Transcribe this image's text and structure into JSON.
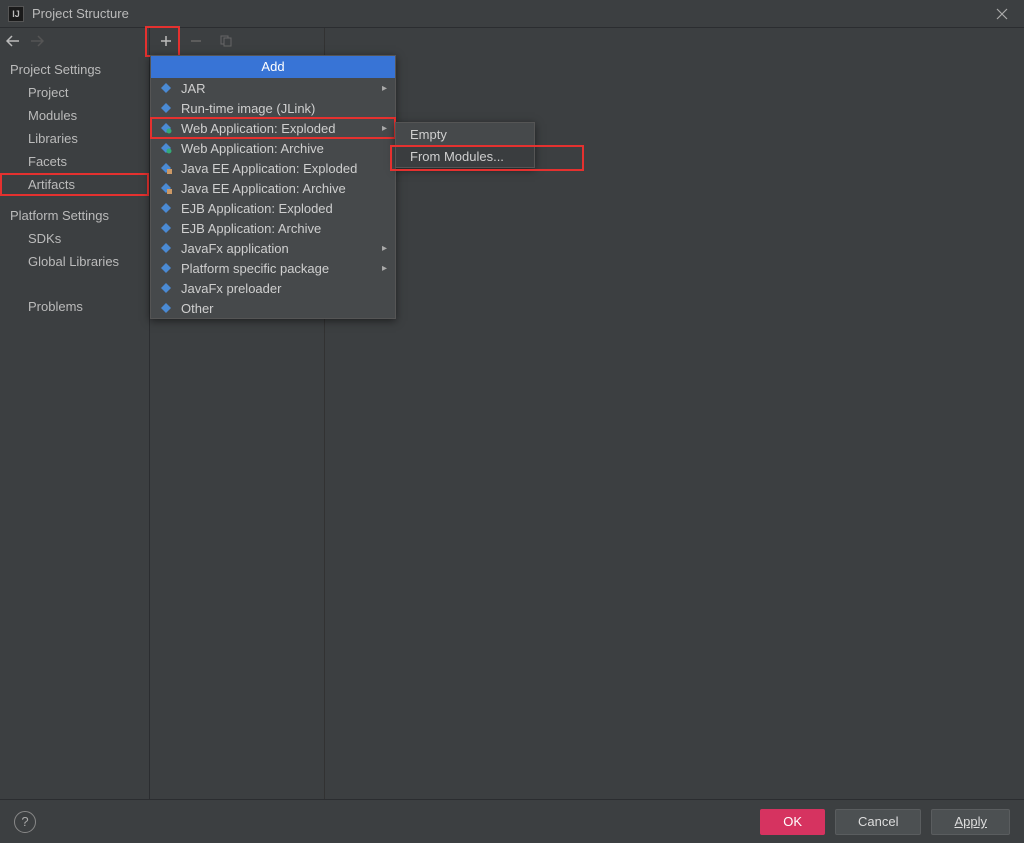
{
  "window": {
    "title": "Project Structure",
    "logo_text": "IJ"
  },
  "sidebar": {
    "project_settings_label": "Project Settings",
    "platform_settings_label": "Platform Settings",
    "items_project": [
      {
        "label": "Project"
      },
      {
        "label": "Modules"
      },
      {
        "label": "Libraries"
      },
      {
        "label": "Facets"
      },
      {
        "label": "Artifacts",
        "selected": true
      }
    ],
    "items_platform": [
      {
        "label": "SDKs"
      },
      {
        "label": "Global Libraries"
      }
    ],
    "problems_label": "Problems"
  },
  "dropdown": {
    "header": "Add",
    "items": [
      {
        "label": "JAR",
        "submenu": true
      },
      {
        "label": "Run-time image (JLink)"
      },
      {
        "label": "Web Application: Exploded",
        "submenu": true,
        "highlight": true
      },
      {
        "label": "Web Application: Archive"
      },
      {
        "label": "Java EE Application: Exploded"
      },
      {
        "label": "Java EE Application: Archive"
      },
      {
        "label": "EJB Application: Exploded"
      },
      {
        "label": "EJB Application: Archive"
      },
      {
        "label": "JavaFx application",
        "submenu": true
      },
      {
        "label": "Platform specific package",
        "submenu": true
      },
      {
        "label": "JavaFx preloader"
      },
      {
        "label": "Other"
      }
    ]
  },
  "submenu": {
    "items": [
      {
        "label": "Empty"
      },
      {
        "label": "From Modules...",
        "hovered": true
      }
    ]
  },
  "buttons": {
    "ok": "OK",
    "cancel": "Cancel",
    "apply": "Apply"
  }
}
